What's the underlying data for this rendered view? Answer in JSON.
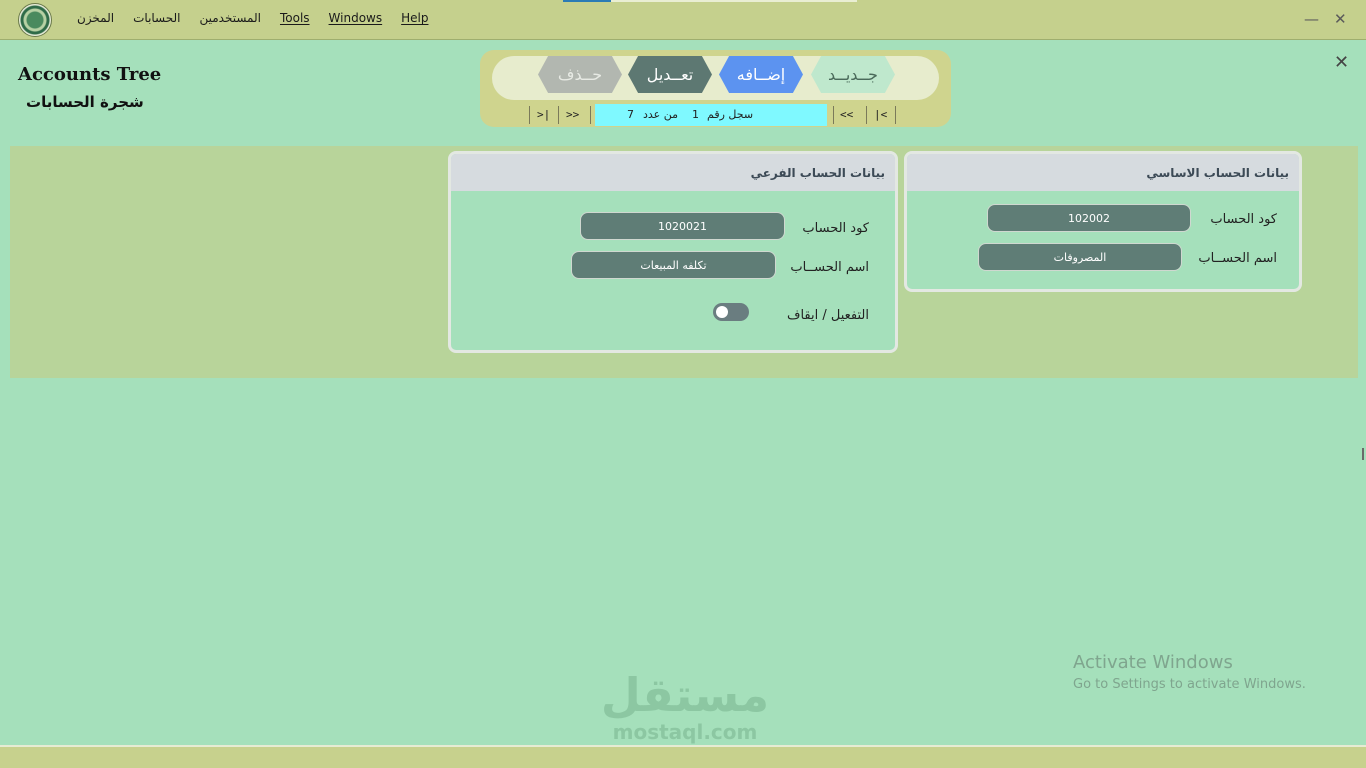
{
  "menu": {
    "items": [
      {
        "label": "المخزن",
        "accel": ""
      },
      {
        "label": "الحسابات",
        "accel": ""
      },
      {
        "label": "المستخدمين",
        "accel": ""
      },
      {
        "label": "Tools",
        "accel": "T"
      },
      {
        "label": "Windows",
        "accel": "W"
      },
      {
        "label": "Help",
        "accel": "H"
      }
    ]
  },
  "window_controls": {
    "minimize": "—",
    "maximize": "▢",
    "close": "✕"
  },
  "form": {
    "close": "✕",
    "title_en": "Accounts Tree",
    "title_ar": "شجرة الحسابات"
  },
  "toolbar": {
    "new_label": "جــديــد",
    "add_label": "إضــافه",
    "edit_label": "تعــديل",
    "delete_label": "حــذف"
  },
  "navigator": {
    "first": "|<",
    "prev": "<<",
    "next": ">>",
    "last": ">|",
    "record_label": "سجل رقم",
    "record_number": "1",
    "of_label": "من عدد",
    "record_count": "7",
    "record_bg": "#7ff9ff"
  },
  "main_account": {
    "header": "بيانات الحساب الاساسي",
    "code_label": "كود الحساب",
    "code_value": "102002",
    "name_label": "اسم الحســاب",
    "name_value": "المصروفات"
  },
  "sub_account": {
    "header": "بيانات الحساب الفرعي",
    "code_label": "كود الحساب",
    "code_value": "1020021",
    "name_label": "اسم الحســاب",
    "name_value": "تكلفه المبيعات",
    "active_label": "التفعيل / ايقاف",
    "active": false
  },
  "activation": {
    "title": "Activate Windows",
    "subtitle": "Go to Settings to activate Windows."
  },
  "watermark": {
    "ar": "مستقل",
    "en": "mostaql.com"
  },
  "colors": {
    "background": "#a5e0bb",
    "menubar": "#c5d08d",
    "panel_band": "#b8d49a",
    "input": "#5f7d76",
    "add_button": "#5c93f0",
    "edit_button": "#5d7872"
  }
}
